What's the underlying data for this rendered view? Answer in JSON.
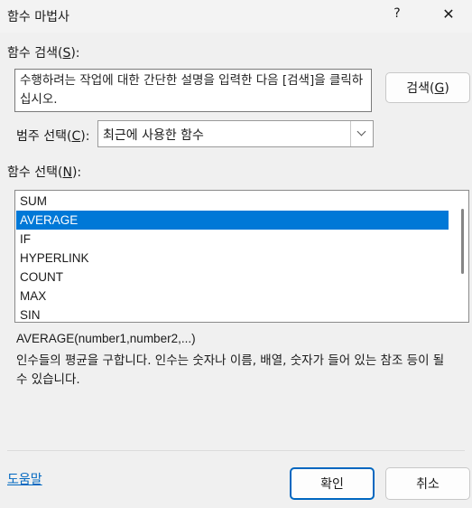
{
  "dialog": {
    "title": "함수 마법사",
    "help_glyph": "?",
    "close_glyph": "✕"
  },
  "search": {
    "label": "함수 검색",
    "label_accel_open": "(",
    "label_accel_key": "S",
    "label_accel_close": "):",
    "input_value": "수행하려는 작업에 대한 간단한 설명을 입력한 다음 [검색]을 클릭하십시오.",
    "button_text": "검색",
    "button_accel_open": "(",
    "button_accel_key": "G",
    "button_accel_close": ")"
  },
  "category": {
    "label": "범주 선택",
    "label_accel_open": "(",
    "label_accel_key": "C",
    "label_accel_close": "):",
    "selected": "최근에 사용한 함수"
  },
  "function_list": {
    "label": "함수 선택",
    "label_accel_open": "(",
    "label_accel_key": "N",
    "label_accel_close": "):",
    "items": [
      "SUM",
      "AVERAGE",
      "IF",
      "HYPERLINK",
      "COUNT",
      "MAX",
      "SIN"
    ],
    "selected_index": 1
  },
  "details": {
    "syntax": "AVERAGE(number1,number2,...)",
    "description": "인수들의 평균을 구합니다. 인수는 숫자나 이름, 배열, 숫자가 들어 있는 참조 등이 될 수 있습니다."
  },
  "footer": {
    "help_link": "도움말",
    "ok": "확인",
    "cancel": "취소"
  },
  "colors": {
    "accent": "#0078d7",
    "link": "#0067c0"
  }
}
